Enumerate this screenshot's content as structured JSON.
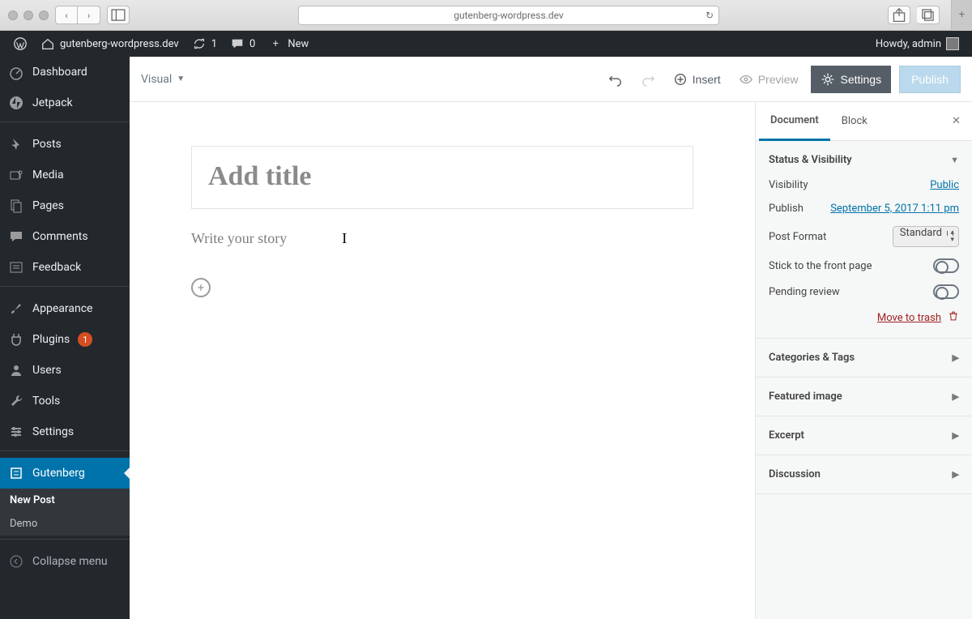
{
  "browser": {
    "url": "gutenberg-wordpress.dev"
  },
  "adminbar": {
    "site": "gutenberg-wordpress.dev",
    "updates": "1",
    "comments": "0",
    "new_label": "New",
    "howdy": "Howdy, admin"
  },
  "sidebar": {
    "items": [
      {
        "label": "Dashboard"
      },
      {
        "label": "Jetpack"
      },
      {
        "label": "Posts"
      },
      {
        "label": "Media"
      },
      {
        "label": "Pages"
      },
      {
        "label": "Comments"
      },
      {
        "label": "Feedback"
      },
      {
        "label": "Appearance"
      },
      {
        "label": "Plugins",
        "badge": "1"
      },
      {
        "label": "Users"
      },
      {
        "label": "Tools"
      },
      {
        "label": "Settings"
      },
      {
        "label": "Gutenberg"
      }
    ],
    "sub": [
      {
        "label": "New Post"
      },
      {
        "label": "Demo"
      }
    ],
    "collapse": "Collapse menu"
  },
  "toolbar": {
    "mode": "Visual",
    "insert": "Insert",
    "preview": "Preview",
    "settings": "Settings",
    "publish": "Publish"
  },
  "editor": {
    "title_placeholder": "Add title",
    "body_placeholder": "Write your story"
  },
  "rpanel": {
    "tabs": {
      "document": "Document",
      "block": "Block"
    },
    "status": {
      "title": "Status & Visibility",
      "visibility_label": "Visibility",
      "visibility_value": "Public",
      "publish_label": "Publish",
      "publish_value": "September 5, 2017 1:11 pm",
      "format_label": "Post Format",
      "format_value": "Standard",
      "sticky_label": "Stick to the front page",
      "pending_label": "Pending review",
      "trash_label": "Move to trash"
    },
    "cats": "Categories & Tags",
    "featured": "Featured image",
    "excerpt": "Excerpt",
    "discussion": "Discussion"
  }
}
